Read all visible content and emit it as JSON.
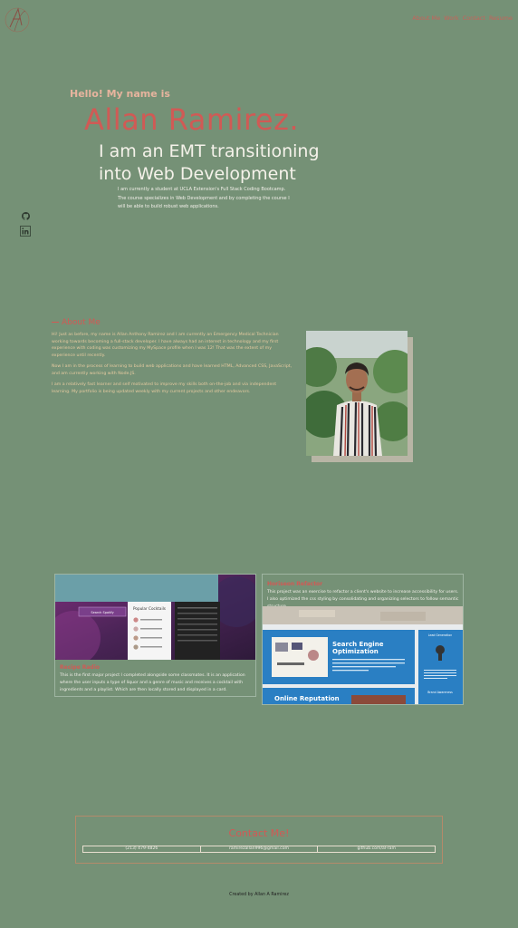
{
  "header": {
    "nav": [
      "About Me",
      "Work",
      "Contact",
      "Resume"
    ]
  },
  "hero": {
    "greeting": "Hello! My name is",
    "name": "Allan Ramirez.",
    "title": "I am an EMT transitioning into Web Development",
    "description": "I am currently a student at UCLA Extension's Full Stack Coding Bootcamp. The course specializes in Web Development and by completing the course I will be able to build robust web applications."
  },
  "social": {
    "github_icon": "github-icon",
    "linkedin_icon": "linkedin-icon"
  },
  "about": {
    "heading": "About Me",
    "paragraphs": [
      "Hi! Just as before, my name is Allan Anthony Ramirez and I am currently an Emergency Medical Technician working towards becoming a full-stack developer. I have always had an interest in technology and my first experience with coding was customizing my MySpace profile when I was 12! That was the extent of my experience until recently.",
      "Now I am in the process of learning to build web applications and have learned HTML, Advanced CSS, JavaScript, and am currently working with Node.JS.",
      "I am a relatively fast learner and self motivated to improve my skills both on-the-job and via independent learning. My portfolio is being updated weekly with my current projects and other endeavors."
    ]
  },
  "projects": [
    {
      "title": "Recipe Radio",
      "description": "This is the first major project I completed alongside some classmates. It is an application where the user inputs a type of liquor and a genre of music and receives a cocktail with ingredients and a playlist. Which are then locally stored and displayed in a card.",
      "screenshot": {
        "button": "Search Spotify",
        "card_title": "Popular Cocktails"
      }
    },
    {
      "title": "Horiseon Refactor",
      "description": "This project was an exercise to refactor a client's website to increase accessibility for users. I also optimized the css styling by consolidating and organizing selectors to follow semantic structure.",
      "screenshot": {
        "seo_title": "Search Engine Optimization",
        "reputation_title": "Online Reputation",
        "lead_title": "Lead Generation",
        "brand_title": "Brand Awareness"
      }
    }
  ],
  "contact": {
    "heading": "Contact Me!",
    "phone": "(213) 479-4826",
    "email": "ramirezallan996@gmail.com",
    "github": "github.com/al-ram"
  },
  "footer": {
    "credit": "Created by Allan A Ramirez"
  },
  "colors": {
    "background": "#759176",
    "accent": "#d05a55",
    "text": "#f3f0ea"
  }
}
